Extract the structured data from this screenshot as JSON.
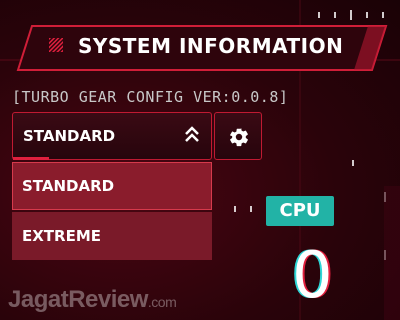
{
  "header": {
    "title": "SYSTEM INFORMATION",
    "subtitle": "[TURBO GEAR CONFIG VER:0.0.8]"
  },
  "mode_dropdown": {
    "selected": "STANDARD",
    "options": [
      "STANDARD",
      "EXTREME"
    ]
  },
  "cpu": {
    "label": "CPU",
    "value": "0"
  },
  "watermark": {
    "brand": "JagatReview",
    "suffix": ".com"
  },
  "colors": {
    "accent_red": "#e0203e",
    "cpu_badge": "#22b3a6",
    "menu_bg": "#7a1a29"
  },
  "icons": [
    "stripes-icon",
    "double-chevron-up-icon",
    "gear-icon"
  ]
}
